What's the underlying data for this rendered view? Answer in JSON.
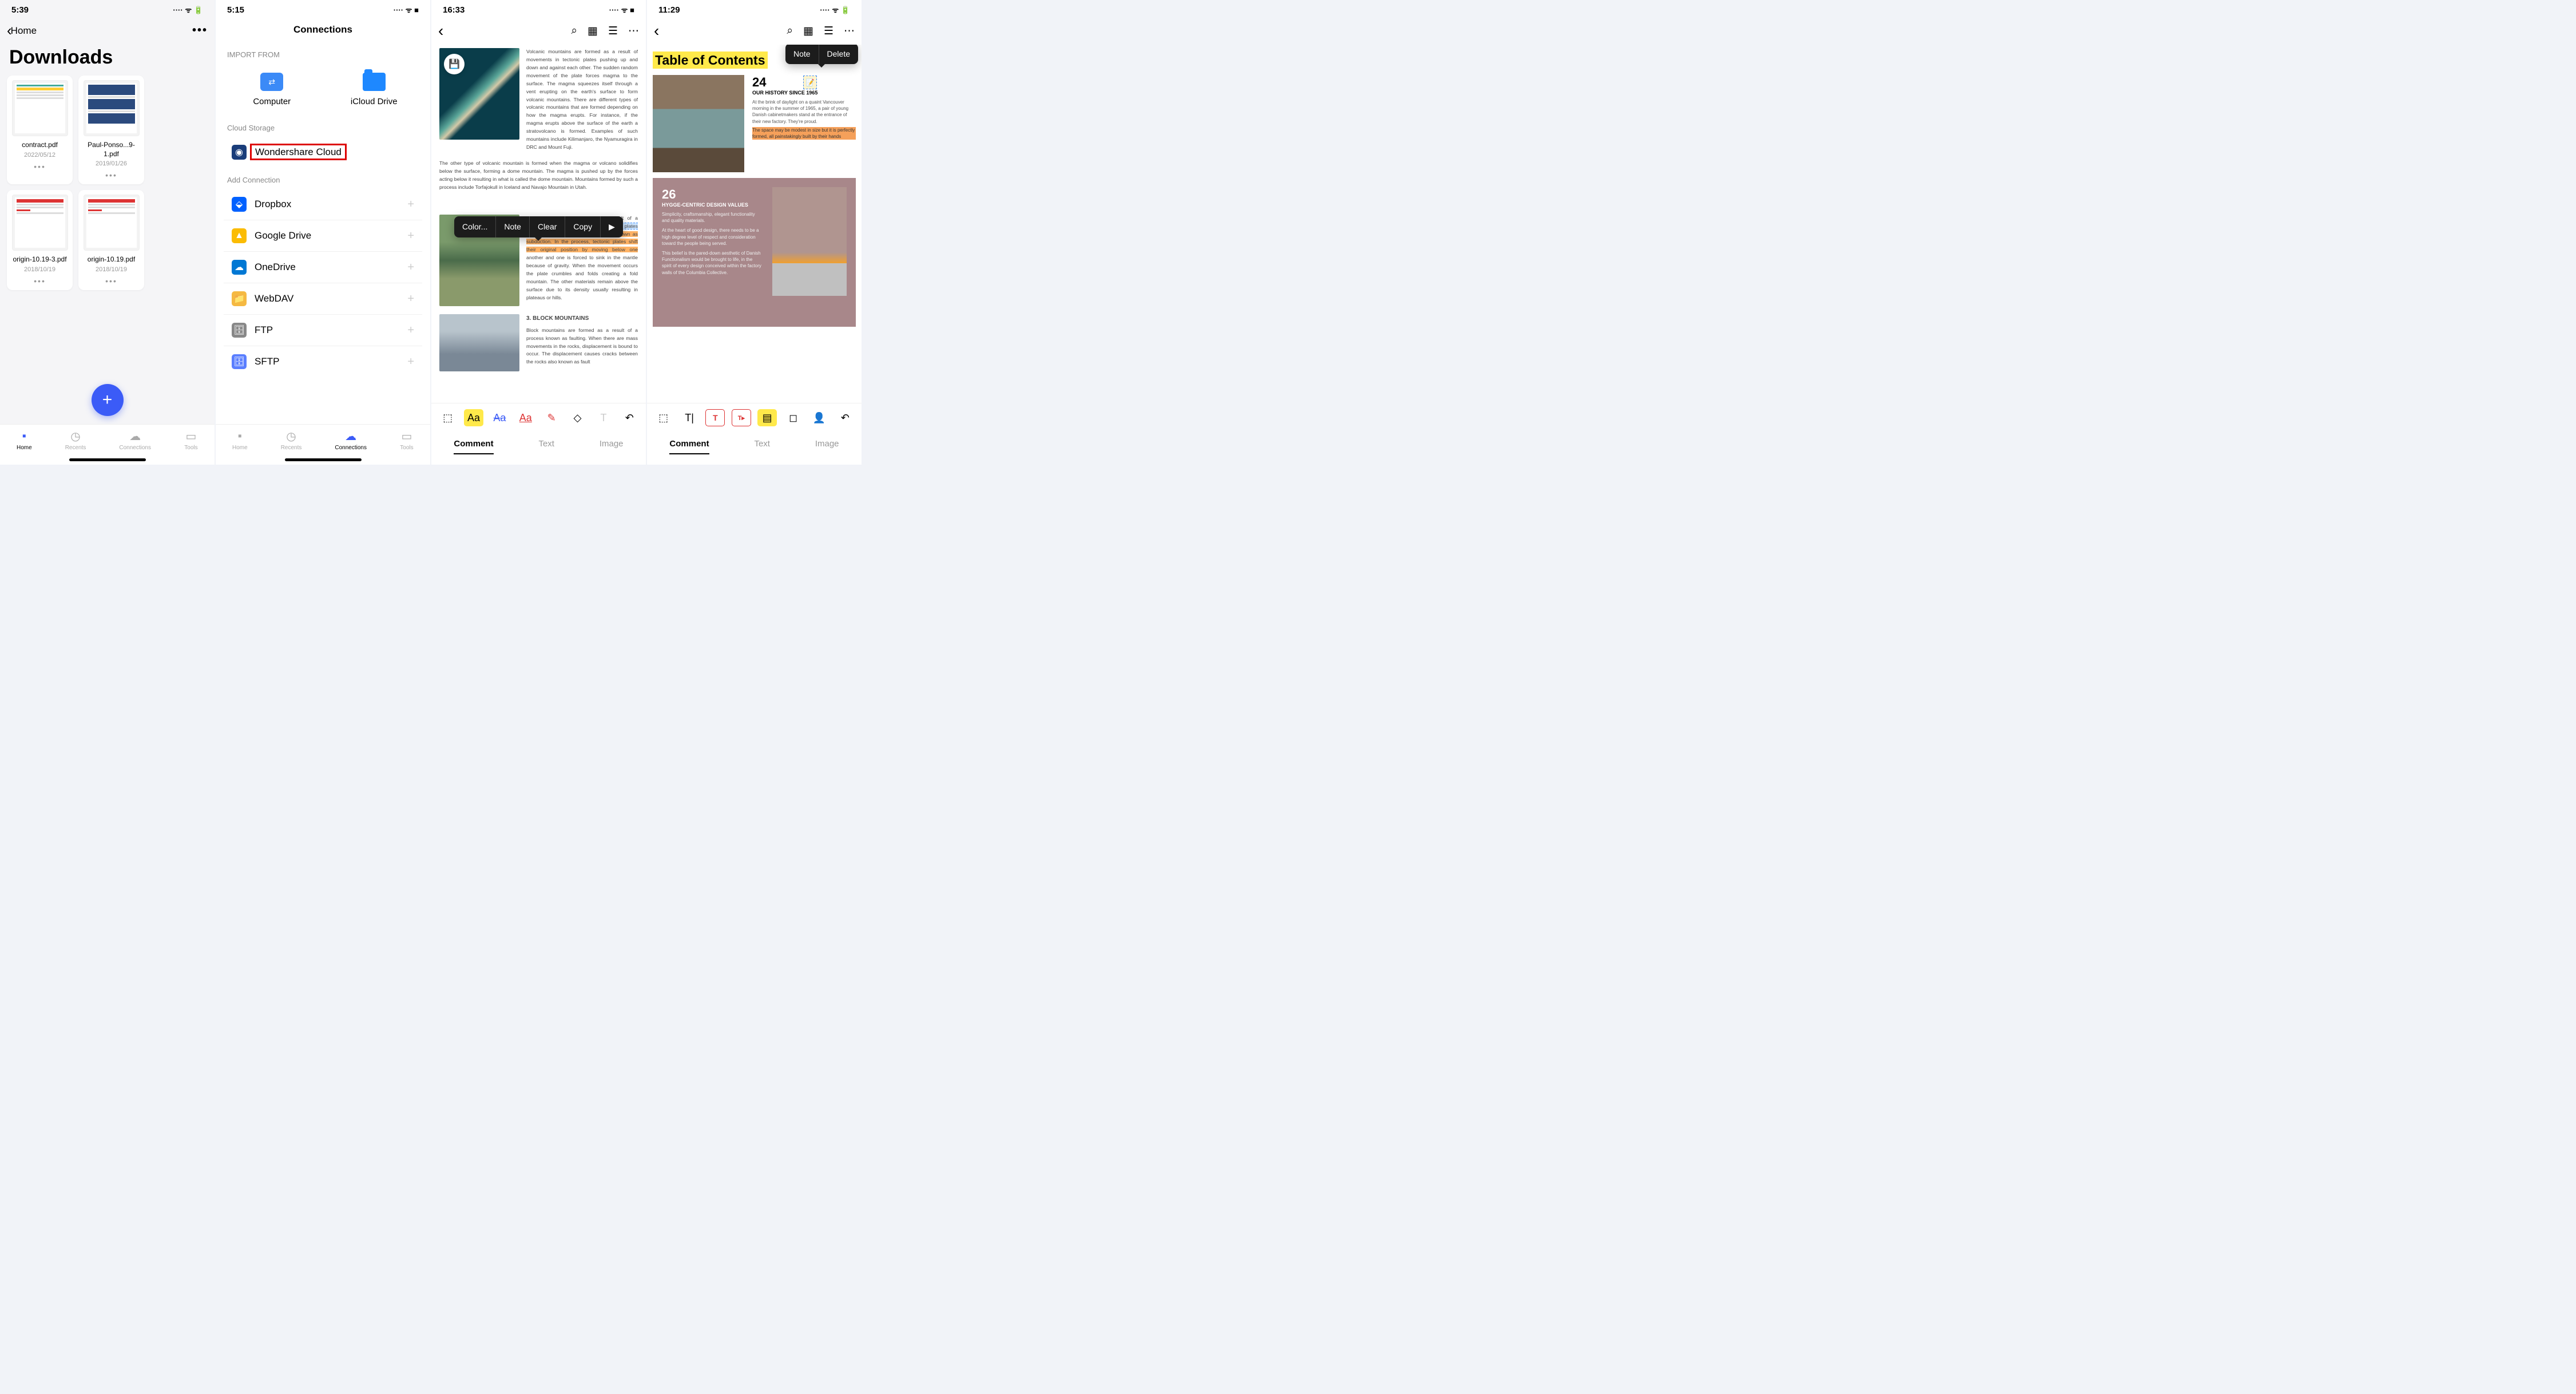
{
  "screen1": {
    "time": "5:39",
    "back_label": "Home",
    "title": "Downloads",
    "files": [
      {
        "name": "contract.pdf",
        "date": "2022/05/12"
      },
      {
        "name": "Paul-Ponso...9-1.pdf",
        "date": "2019/01/26"
      },
      {
        "name": "origin-10.19-3.pdf",
        "date": "2018/10/19"
      },
      {
        "name": "origin-10.19.pdf",
        "date": "2018/10/19"
      }
    ],
    "tabs": {
      "home": "Home",
      "recents": "Recents",
      "connections": "Connections",
      "tools": "Tools"
    }
  },
  "screen2": {
    "time": "5:15",
    "title": "Connections",
    "import_from": "IMPORT FROM",
    "computer": "Computer",
    "icloud": "iCloud Drive",
    "cloud_storage": "Cloud Storage",
    "wondershare": "Wondershare Cloud",
    "add_connection": "Add Connection",
    "services": [
      {
        "name": "Dropbox",
        "color": "#0061ff",
        "glyph": "⬙"
      },
      {
        "name": "Google Drive",
        "color": "#fbbc04",
        "glyph": "▲"
      },
      {
        "name": "OneDrive",
        "color": "#0078d4",
        "glyph": "☁"
      },
      {
        "name": "WebDAV",
        "color": "#f5b942",
        "glyph": "📁"
      },
      {
        "name": "FTP",
        "color": "#888",
        "glyph": "🗄"
      },
      {
        "name": "SFTP",
        "color": "#5b7fff",
        "glyph": "🗄"
      }
    ],
    "tabs": {
      "home": "Home",
      "recents": "Recents",
      "connections": "Connections",
      "tools": "Tools"
    }
  },
  "screen3": {
    "time": "16:33",
    "para1": "Volcanic mountains are formed as a result of movements in tectonic plates pushing up and down and against each other. The sudden random movement of the plate forces magma to the surface. The magma squeezes itself through a vent erupting on the earth's surface to form volcanic mountains. There are different types of volcanic mountains that are formed depending on how the magma erupts. For instance, if the magma erupts above the surface of the earth a stratovolcano is formed. Examples of such mountains include Kilimanjaro, the Nyamuragira in DRC and Mount Fuji.",
    "para2": "The other type of volcanic mountain is formed when the magma or volcano solidifies below the surface, forming a dome mountain. The magma is pushed up by the forces acting below it resulting in what is called the dome mountain. Mountains formed by such a process include Torfajokull in Iceland and Navajo Mountain in Utah.",
    "para3a": "Fold mountains are formed as a result of a collision ",
    "para3b": "between the tectonic plates. The plates then ",
    "para3c": "go through a geological process known as subduction. In the process, tectonic plates shift their original position by moving below one",
    "para3d": " another and one is forced to sink in the mantle because of gravity. When the movement occurs the plate crumbles and folds creating a fold mountain. The other materials remain above the surface due to its density usually resulting in plateaus or hills.",
    "heading3": "3. BLOCK MOUNTAINS",
    "para4": "Block mountains are formed as a result of a process known as faulting. When there are mass movements in the rocks, displacement is bound to occur. The displacement causes cracks between the rocks also known as fault",
    "menu": {
      "color": "Color...",
      "note": "Note",
      "clear": "Clear",
      "copy": "Copy",
      "arrow": "▶"
    },
    "modes": {
      "comment": "Comment",
      "text": "Text",
      "image": "Image"
    }
  },
  "screen4": {
    "time": "11:29",
    "toc": "Table of Contents",
    "menu": {
      "note": "Note",
      "delete": "Delete"
    },
    "sec1_num": "24",
    "sec1_title": "OUR HISTORY SINCE 1965",
    "sec1_body": "At the brink of daylight on a quaint Vancouver morning in the summer of 1965, a pair of young Danish cabinetmakers stand at the entrance of their new factory. They're proud.",
    "sec1_hl": "The space may be modest in size but it is perfectly formed, all painstakingly built by their hands",
    "sec2_num": "26",
    "sec2_title": "HYGGE-CENTRIC DESIGN VALUES",
    "sec2_body1": "Simplicity, craftsmanship, elegant functionality and quality materials.",
    "sec2_body2": "At the heart of good design, there needs to be a high degree level of respect and consideration toward the people being served.",
    "sec2_body3": "This belief is the pared-down aesthetic of Danish Functionalism would be brought to life, in the spirit of every design conceived within the factory walls of the Columbia Collective.",
    "modes": {
      "comment": "Comment",
      "text": "Text",
      "image": "Image"
    }
  }
}
